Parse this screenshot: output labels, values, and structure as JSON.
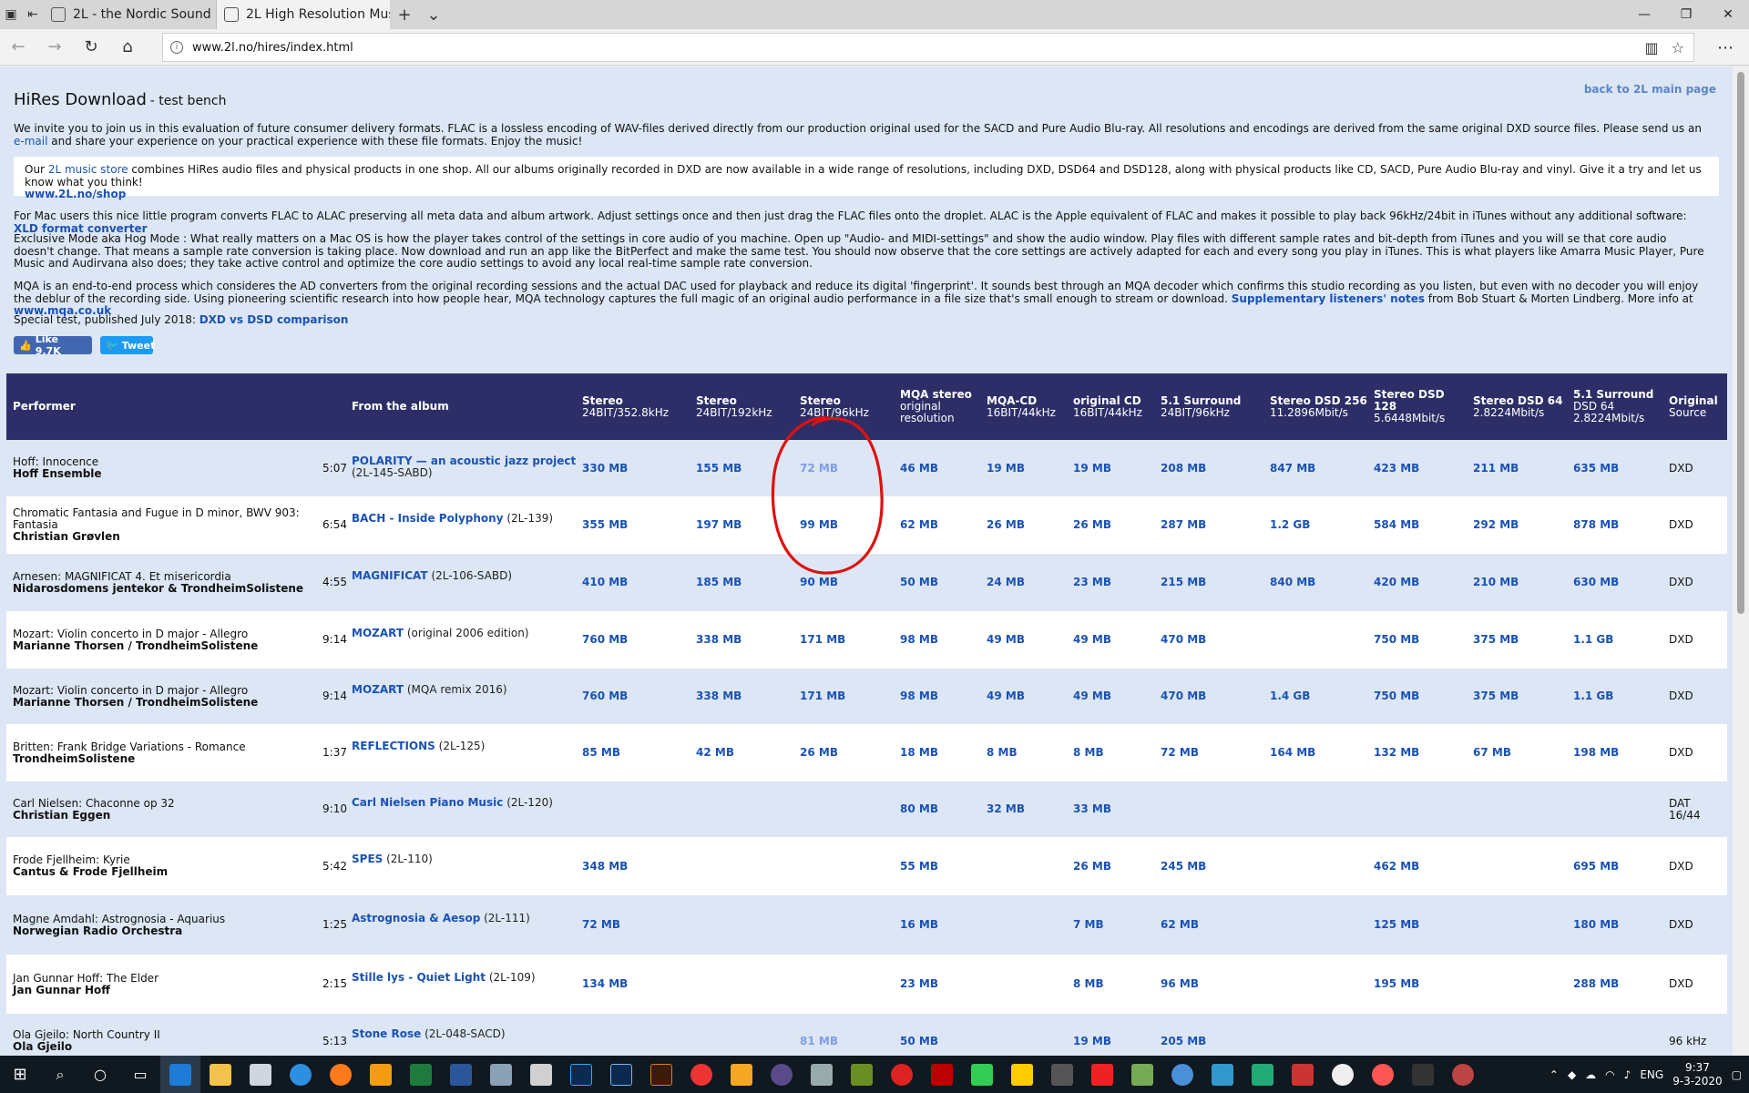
{
  "browser": {
    "tabs": [
      {
        "title": "2L - the Nordic Sound",
        "active": false
      },
      {
        "title": "2L High Resolution Mus",
        "active": true
      }
    ],
    "url": "www.2l.no/hires/index.html"
  },
  "page": {
    "back_link": "back to 2L main page",
    "title": "HiRes Download",
    "subtitle": "- test bench",
    "intro_text": "We invite you to join us in this evaluation of future consumer delivery formats. FLAC is a lossless encoding of WAV-files derived directly from our production original used for the SACD and Pure Audio Blu-ray. All resolutions and encodings are derived from the same original DXD source files. Please send us an ",
    "intro_link": "e-mail",
    "intro_text2": " and share your experience on your practical experience with these file formats. Enjoy the music!",
    "store_pre": "Our ",
    "store_link": "2L music store",
    "store_text": " combines HiRes audio files and physical products in one shop. All our albums originally recorded in DXD are now available in a wide range of resolutions, including DXD, DSD64 and DSD128, along with physical products like CD, SACD, Pure Audio Blu-ray and vinyl. Give it a try and let us know what you think!",
    "store_url": "www.2L.no/shop",
    "mac_text": "For Mac users this nice little program converts FLAC to ALAC preserving all meta data and album artwork. Adjust settings once and then just drag the FLAC files onto the droplet. ALAC is the Apple equivalent of FLAC and makes it possible to play back 96kHz/24bit in iTunes without any additional software: ",
    "mac_link": "XLD format converter",
    "hog_text": "Exclusive Mode aka Hog Mode : What really matters on a Mac OS is how the player takes control of the settings in core audio of you machine. Open up \"Audio- and MIDI-settings\" and show the audio window. Play files with different sample rates and bit-depth from iTunes and you will se that core audio doesn't change. That means a sample rate conversion is taking place. Now download and run an app like the BitPerfect and make the same test. You should now observe that the core settings are actively adapted for each and every song you play in iTunes. This is what players like Amarra Music Player, Pure Music and Audirvana also does; they take active control and optimize the core audio settings to avoid any local real-time sample rate conversion.",
    "mqa_text": "MQA is an end-to-end process which consideres the AD converters from the original recording sessions and the actual DAC used for playback and reduce its digital 'fingerprint'. It sounds best through an MQA decoder which confirms this studio recording as you listen, but even with no decoder you will enjoy the deblur of the recording side. Using pioneering scientific research into how people hear, MQA technology captures the full magic of an original audio performance in a file size that's small enough to stream or download. ",
    "mqa_link": "Supplementary listeners' notes",
    "mqa_text2": " from Bob Stuart & Morten Lindberg. More info at ",
    "mqa_link2": "www.mqa.co.uk",
    "special_text": "Special test, published July 2018: ",
    "special_link": "DXD vs DSD comparison",
    "like_label": "Like 9.7K",
    "tweet_label": "Tweet"
  },
  "table": {
    "headers": [
      {
        "t": "Performer",
        "s": ""
      },
      {
        "t": "From the album",
        "s": ""
      },
      {
        "t": "Stereo",
        "s": "24BIT/352.8kHz"
      },
      {
        "t": "Stereo",
        "s": "24BIT/192kHz"
      },
      {
        "t": "Stereo",
        "s": "24BIT/96kHz"
      },
      {
        "t": "MQA stereo",
        "s": "original resolution"
      },
      {
        "t": "MQA-CD",
        "s": "16BIT/44kHz"
      },
      {
        "t": "original CD",
        "s": "16BIT/44kHz"
      },
      {
        "t": "5.1 Surround",
        "s": "24BIT/96kHz"
      },
      {
        "t": "Stereo DSD 256",
        "s": "11.2896Mbit/s"
      },
      {
        "t": "Stereo DSD 128",
        "s": "5.6448Mbit/s"
      },
      {
        "t": "Stereo DSD 64",
        "s": "2.8224Mbit/s"
      },
      {
        "t": "5.1 Surround",
        "s": "DSD 64 2.8224Mbit/s"
      },
      {
        "t": "Original",
        "s": "Source"
      }
    ],
    "rows": [
      {
        "title": "Hoff: Innocence",
        "name": "Hoff Ensemble",
        "dur": "5:07",
        "album": "POLARITY — an acoustic jazz project",
        "cat": "(2L-145-SABD)",
        "sizes": [
          "330 MB",
          "155 MB",
          "72 MB",
          "46 MB",
          "19 MB",
          "19 MB",
          "208 MB",
          "847 MB",
          "423 MB",
          "211 MB",
          "635 MB"
        ],
        "src": "DXD"
      },
      {
        "title": "Chromatic Fantasia and Fugue in D minor, BWV 903: Fantasia",
        "name": "Christian Grøvlen",
        "dur": "6:54",
        "album": "BACH - Inside Polyphony",
        "cat": "(2L-139)",
        "sizes": [
          "355 MB",
          "197 MB",
          "99 MB",
          "62 MB",
          "26 MB",
          "26 MB",
          "287 MB",
          "1.2 GB",
          "584 MB",
          "292 MB",
          "878 MB"
        ],
        "src": "DXD"
      },
      {
        "title": "Arnesen: MAGNIFICAT 4. Et misericordia",
        "name": "Nidarosdomens jentekor & TrondheimSolistene",
        "dur": "4:55",
        "album": "MAGNIFICAT",
        "cat": "(2L-106-SABD)",
        "sizes": [
          "410 MB",
          "185 MB",
          "90 MB",
          "50 MB",
          "24 MB",
          "23 MB",
          "215 MB",
          "840 MB",
          "420 MB",
          "210 MB",
          "630 MB"
        ],
        "src": "DXD"
      },
      {
        "title": "Mozart: Violin concerto in D major - Allegro",
        "name": "Marianne Thorsen / TrondheimSolistene",
        "dur": "9:14",
        "album": "MOZART",
        "cat": "(original 2006 edition)",
        "sizes": [
          "760 MB",
          "338 MB",
          "171 MB",
          "98 MB",
          "49 MB",
          "49 MB",
          "470 MB",
          "",
          "750 MB",
          "375 MB",
          "1.1 GB"
        ],
        "src": "DXD"
      },
      {
        "title": "Mozart: Violin concerto in D major - Allegro",
        "name": "Marianne Thorsen / TrondheimSolistene",
        "dur": "9:14",
        "album": "MOZART",
        "cat": "(MQA remix 2016)",
        "sizes": [
          "760 MB",
          "338 MB",
          "171 MB",
          "98 MB",
          "49 MB",
          "49 MB",
          "470 MB",
          "1.4 GB",
          "750 MB",
          "375 MB",
          "1.1 GB"
        ],
        "src": "DXD"
      },
      {
        "title": "Britten: Frank Bridge Variations - Romance",
        "name": "TrondheimSolistene",
        "dur": "1:37",
        "album": "REFLECTIONS",
        "cat": "(2L-125)",
        "sizes": [
          "85 MB",
          "42 MB",
          "26 MB",
          "18 MB",
          "8 MB",
          "8 MB",
          "72 MB",
          "164 MB",
          "132 MB",
          "67 MB",
          "198 MB"
        ],
        "src": "DXD"
      },
      {
        "title": "Carl Nielsen: Chaconne op 32",
        "name": "Christian Eggen",
        "dur": "9:10",
        "album": "Carl Nielsen Piano Music",
        "cat": "(2L-120)",
        "sizes": [
          "",
          "",
          "",
          "80 MB",
          "32 MB",
          "33 MB",
          "",
          "",
          "",
          "",
          ""
        ],
        "src": "DAT 16/44"
      },
      {
        "title": "Frode Fjellheim: Kyrie",
        "name": "Cantus & Frode Fjellheim",
        "dur": "5:42",
        "album": "SPES",
        "cat": "(2L-110)",
        "sizes": [
          "348 MB",
          "",
          "",
          "55 MB",
          "",
          "26 MB",
          "245 MB",
          "",
          "462 MB",
          "",
          "695 MB"
        ],
        "src": "DXD"
      },
      {
        "title": "Magne Amdahl: Astrognosia - Aquarius",
        "name": "Norwegian Radio Orchestra",
        "dur": "1:25",
        "album": "Astrognosia & Aesop",
        "cat": "(2L-111)",
        "sizes": [
          "72 MB",
          "",
          "",
          "16 MB",
          "",
          "7 MB",
          "62 MB",
          "",
          "125 MB",
          "",
          "180 MB"
        ],
        "src": "DXD"
      },
      {
        "title": "Jan Gunnar Hoff: The Elder",
        "name": "Jan Gunnar Hoff",
        "dur": "2:15",
        "album": "Stille lys - Quiet Light",
        "cat": "(2L-109)",
        "sizes": [
          "134 MB",
          "",
          "",
          "23 MB",
          "",
          "8 MB",
          "96 MB",
          "",
          "195 MB",
          "",
          "288 MB"
        ],
        "src": "DXD"
      },
      {
        "title": "Ola Gjeilo: North Country II",
        "name": "Ola Gjeilo",
        "dur": "5:13",
        "album": "Stone Rose",
        "cat": "(2L-048-SACD)",
        "sizes": [
          "",
          "",
          "81 MB",
          "50 MB",
          "",
          "19 MB",
          "205 MB",
          "",
          "",
          "",
          ""
        ],
        "src": "96 kHz"
      }
    ]
  },
  "taskbar": {
    "lang": "ENG",
    "time": "9:37",
    "date": "9-3-2020"
  }
}
